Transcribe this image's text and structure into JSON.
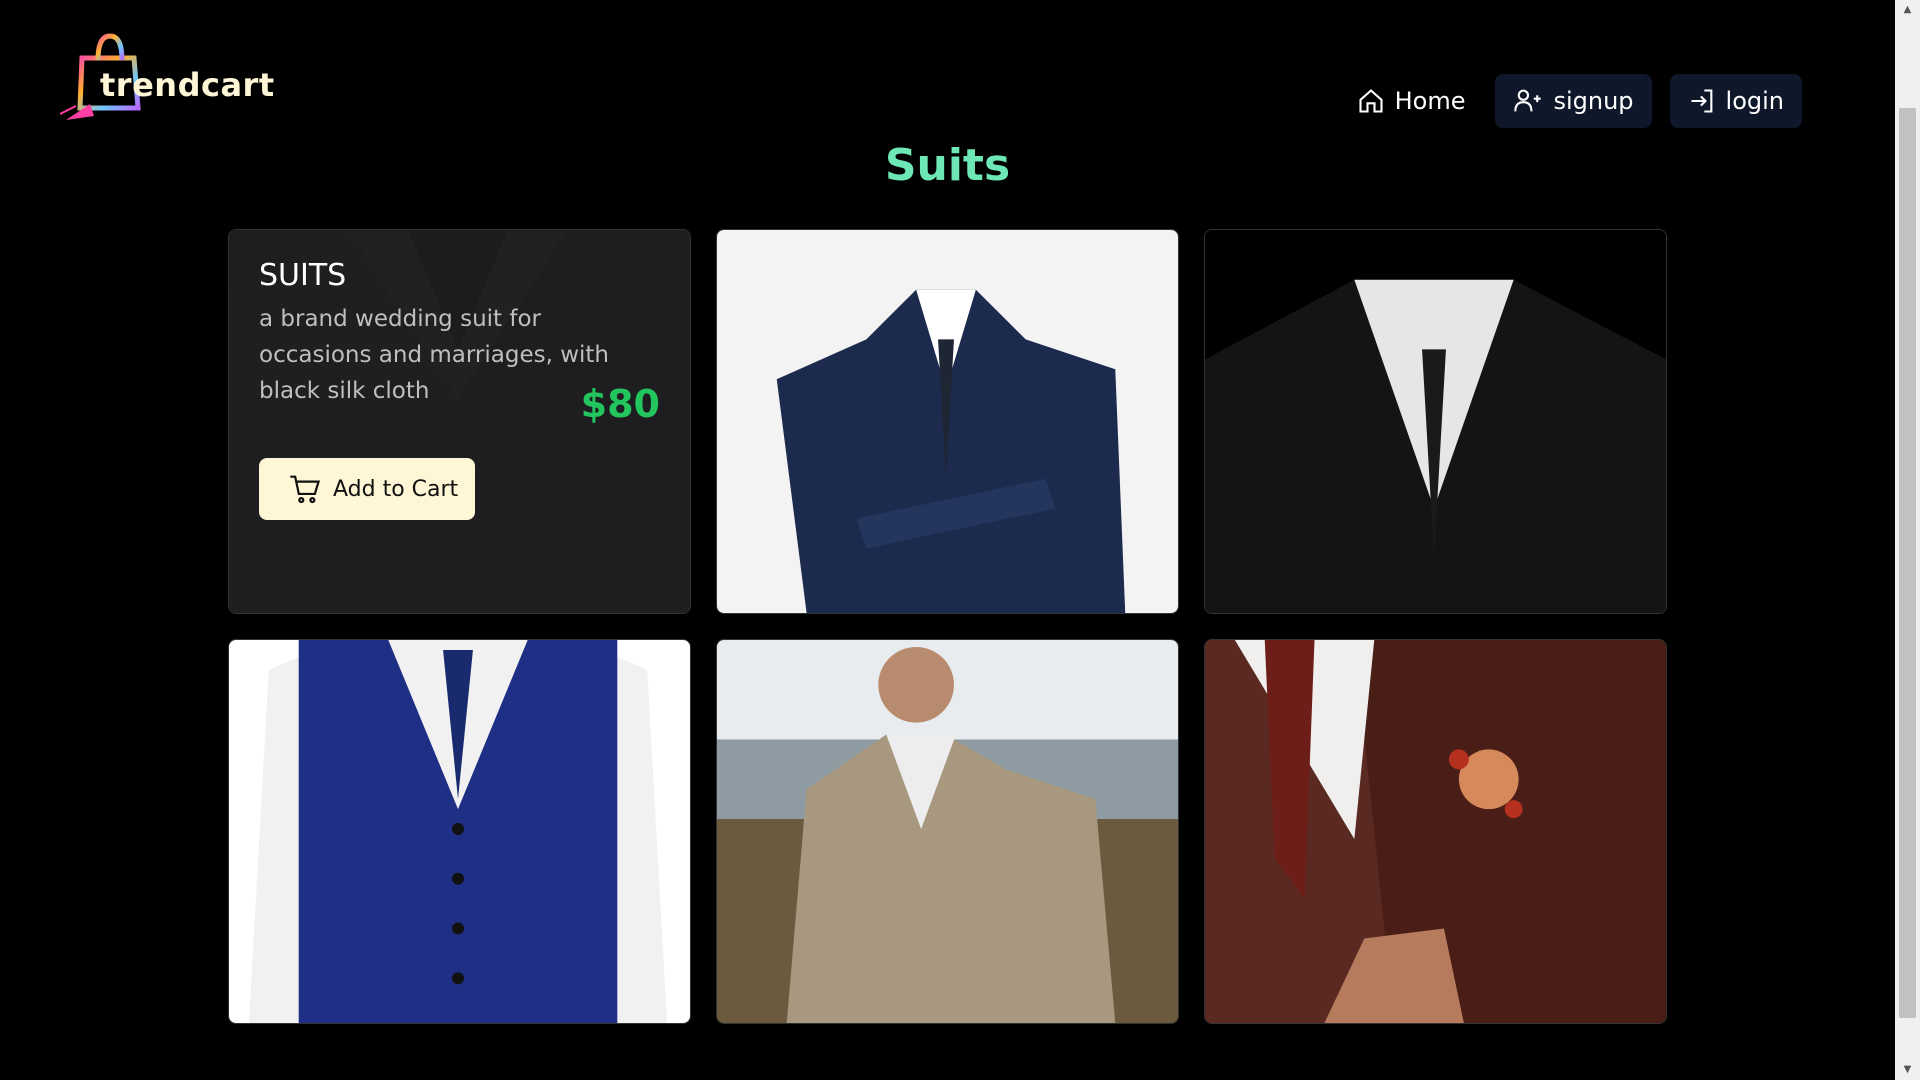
{
  "brand": {
    "name": "trendcart"
  },
  "nav": {
    "home": "Home",
    "signup": "signup",
    "login": "login"
  },
  "page": {
    "title": "Suits"
  },
  "product": {
    "name": "SUITS",
    "description": "a brand wedding suit for occasions and marriages, with black silk cloth",
    "price": "$80",
    "cart_label": "Add to Cart"
  },
  "colors": {
    "title": "#6ee7b7",
    "price": "#22c55e",
    "cart_button": "#fff6d6",
    "nav_button": "#0f172a"
  },
  "icons": {
    "home": "home-icon",
    "signup": "user-plus-icon",
    "login": "log-in-icon",
    "cart": "cart-icon"
  }
}
